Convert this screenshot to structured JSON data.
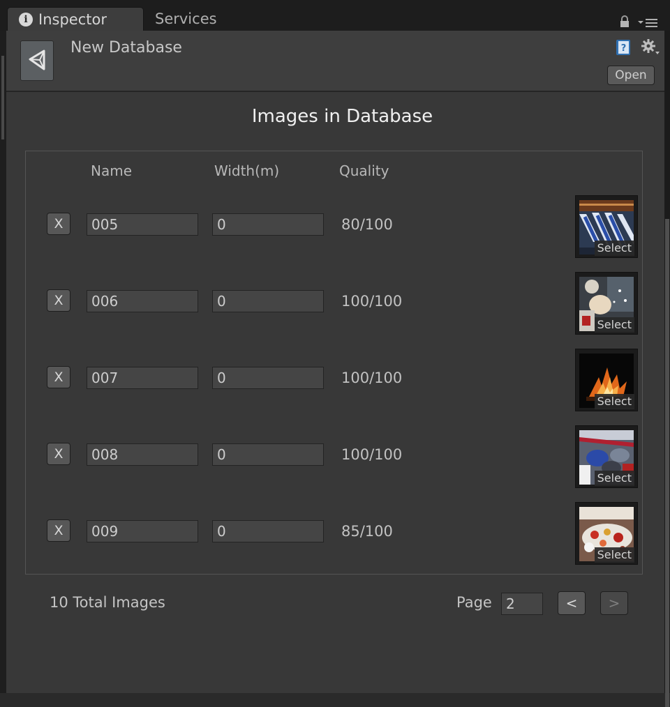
{
  "tabs": [
    {
      "label": "Inspector",
      "icon": "info-icon",
      "active": true
    },
    {
      "label": "Services",
      "active": false
    }
  ],
  "header": {
    "title": "New Database",
    "open_label": "Open"
  },
  "section_title": "Images in Database",
  "columns": {
    "name": "Name",
    "width": "Width(m)",
    "quality": "Quality"
  },
  "rows": [
    {
      "remove_label": "X",
      "name": "005",
      "width": "0",
      "quality": "80/100",
      "select_label": "Select"
    },
    {
      "remove_label": "X",
      "name": "006",
      "width": "0",
      "quality": "100/100",
      "select_label": "Select"
    },
    {
      "remove_label": "X",
      "name": "007",
      "width": "0",
      "quality": "100/100",
      "select_label": "Select"
    },
    {
      "remove_label": "X",
      "name": "008",
      "width": "0",
      "quality": "100/100",
      "select_label": "Select"
    },
    {
      "remove_label": "X",
      "name": "009",
      "width": "0",
      "quality": "85/100",
      "select_label": "Select"
    }
  ],
  "footer": {
    "total": "10 Total Images",
    "page_label": "Page",
    "page_value": "2",
    "prev_label": "<",
    "next_label": ">"
  },
  "colors": {
    "panel_bg": "#383838",
    "header_bg": "#3e3e3e",
    "text": "#c4c4c4"
  }
}
